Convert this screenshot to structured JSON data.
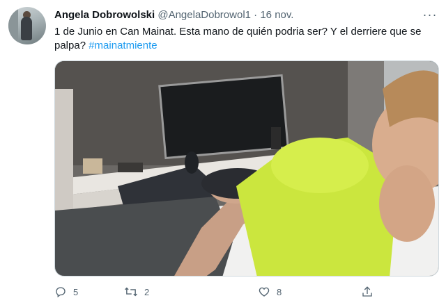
{
  "tweet": {
    "author_name": "Angela Dobrowolski",
    "author_handle": "@AngelaDobrowol1",
    "separator": "·",
    "date": "16 nov.",
    "text_main": "1 de Junio en Can Mainat. Esta mano de quién podria ser? Y el derriere que se palpa? ",
    "hashtag": "#mainatmiente",
    "more_glyph": "···"
  },
  "actions": {
    "replies": "5",
    "retweets": "2",
    "likes": "8"
  },
  "icons": {
    "avatar": "profile-photo",
    "more": "more-horizontal-icon",
    "reply": "reply-icon",
    "retweet": "retweet-icon",
    "like": "heart-icon",
    "share": "share-icon"
  },
  "colors": {
    "text": "#0f1419",
    "secondary": "#536471",
    "link": "#1d9bf0",
    "border": "#cfd9de"
  }
}
